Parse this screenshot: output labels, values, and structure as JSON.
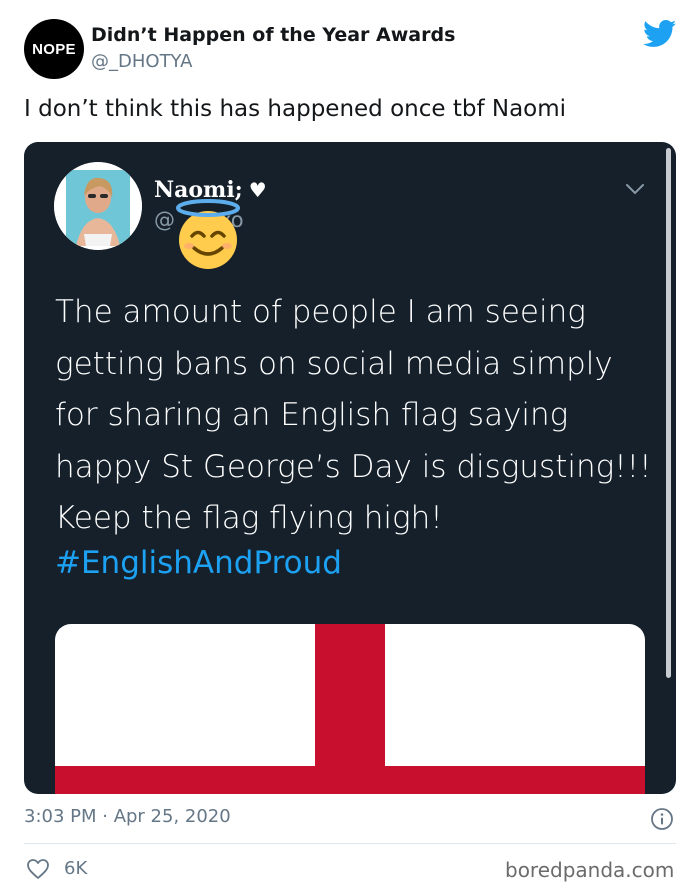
{
  "tweet": {
    "avatar_text": "NOPE",
    "display_name": "Didn’t Happen of the Year Awards",
    "handle": "@_DHOTYA",
    "text": "I don’t think this has happened once tbf Naomi",
    "timestamp": "3:03 PM · Apr 25, 2020",
    "likes": "6K",
    "brand_color": "#1da1f2"
  },
  "quoted": {
    "name": "Naomi;",
    "handle_start": "@",
    "handle_end": "xo",
    "body_lines": [
      "The amount of people I am seeing",
      "getting bans on social media simply",
      "for sharing an English flag saying",
      "happy St George’s Day is disgusting!!!",
      "Keep the flag flying high!"
    ],
    "hashtag": "#EnglishAndProud",
    "background": "#15202b",
    "flag_red": "#c8102e"
  },
  "watermark": "boredpanda.com"
}
